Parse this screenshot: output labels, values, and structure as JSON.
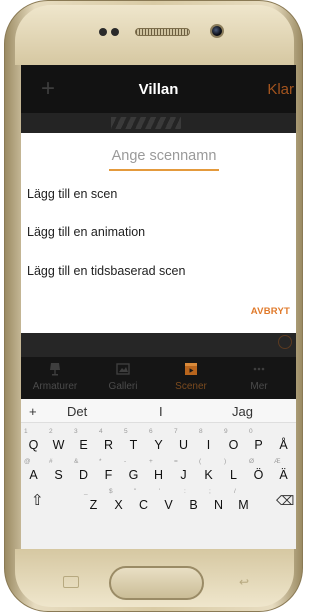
{
  "app_bar": {
    "plus_icon": "+",
    "title": "Villan",
    "done_label": "Klar"
  },
  "dialog": {
    "input_placeholder": "Ange scennamn",
    "options": [
      "Lägg till en scen",
      "Lägg till en animation",
      "Lägg till en tidsbaserad scen"
    ],
    "cancel_label": "AVBRYT",
    "accent_color": "#e07a2b"
  },
  "tabs": [
    {
      "label": "Armaturer",
      "icon": "lamp-icon",
      "active": false
    },
    {
      "label": "Galleri",
      "icon": "gallery-icon",
      "active": false
    },
    {
      "label": "Scener",
      "icon": "film-icon",
      "active": true
    },
    {
      "label": "Mer",
      "icon": "more-dots-icon",
      "active": false
    }
  ],
  "keyboard": {
    "suggestions": {
      "plus": "+",
      "left": "Det",
      "middle": "I",
      "right": "Jag"
    },
    "row1": [
      {
        "main": "Q",
        "sub": "1"
      },
      {
        "main": "W",
        "sub": "2"
      },
      {
        "main": "E",
        "sub": "3"
      },
      {
        "main": "R",
        "sub": "4"
      },
      {
        "main": "T",
        "sub": "5"
      },
      {
        "main": "Y",
        "sub": "6"
      },
      {
        "main": "U",
        "sub": "7"
      },
      {
        "main": "I",
        "sub": "8"
      },
      {
        "main": "O",
        "sub": "9"
      },
      {
        "main": "P",
        "sub": "0"
      },
      {
        "main": "Å",
        "sub": ""
      }
    ],
    "row2": [
      {
        "main": "A",
        "sub": "@"
      },
      {
        "main": "S",
        "sub": "#"
      },
      {
        "main": "D",
        "sub": "&"
      },
      {
        "main": "F",
        "sub": "*"
      },
      {
        "main": "G",
        "sub": "-"
      },
      {
        "main": "H",
        "sub": "+"
      },
      {
        "main": "J",
        "sub": "="
      },
      {
        "main": "K",
        "sub": "("
      },
      {
        "main": "L",
        "sub": ")"
      },
      {
        "main": "Ö",
        "sub": "Ø"
      },
      {
        "main": "Ä",
        "sub": "Æ"
      }
    ],
    "row3": [
      {
        "main": "Z",
        "sub": "_"
      },
      {
        "main": "X",
        "sub": "$"
      },
      {
        "main": "C",
        "sub": "\""
      },
      {
        "main": "V",
        "sub": "'"
      },
      {
        "main": "B",
        "sub": ":"
      },
      {
        "main": "N",
        "sub": ";"
      },
      {
        "main": "M",
        "sub": "/"
      }
    ],
    "shift_icon": "⇧",
    "backspace_icon": "⌫"
  }
}
